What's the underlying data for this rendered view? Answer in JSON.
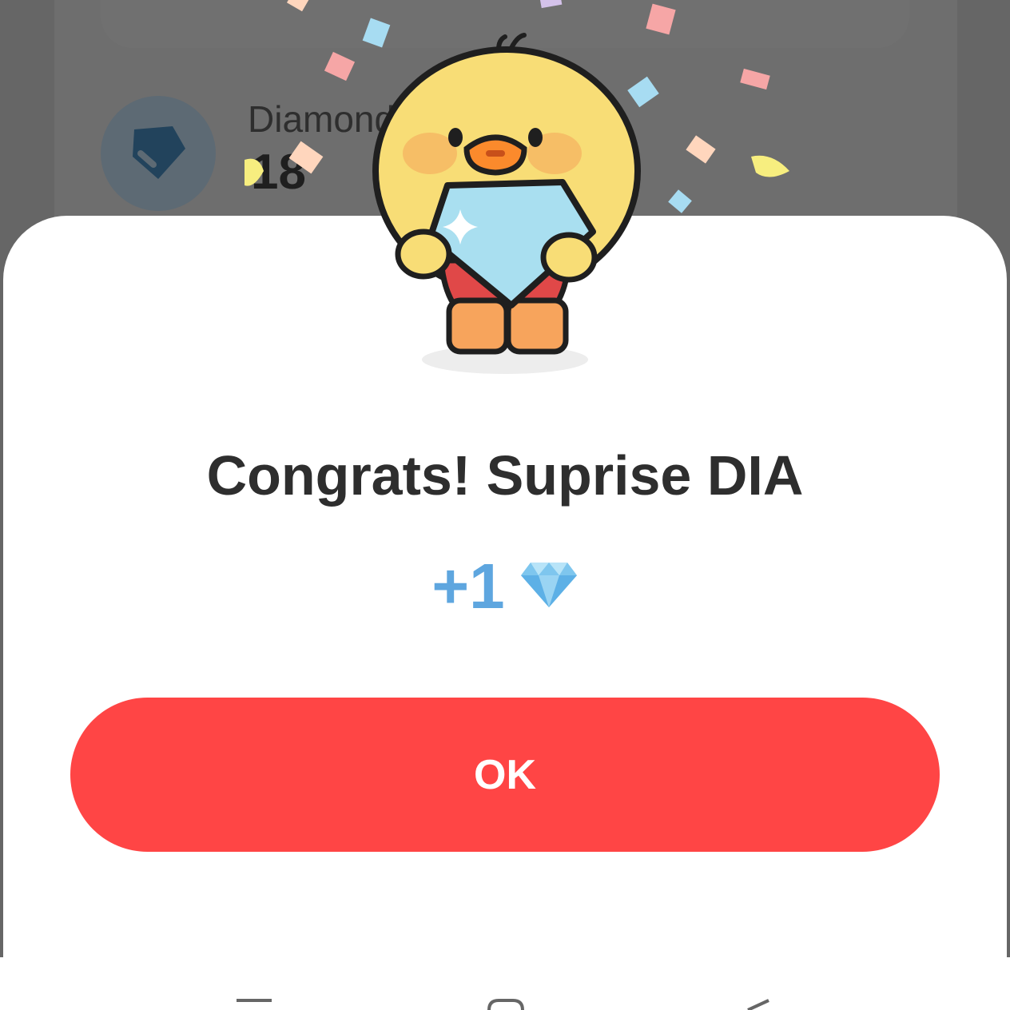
{
  "background": {
    "item_label": "Diamond",
    "item_count": "18"
  },
  "dialog": {
    "title": "Congrats! Suprise DIA",
    "reward_amount": "+1",
    "ok_label": "OK"
  },
  "colors": {
    "accent": "#ff4545",
    "reward_text": "#5ea6df",
    "title_text": "#2e2e2e"
  },
  "icons": {
    "mascot": "duck-holding-diamond-icon",
    "reward": "diamond-icon",
    "background_item": "gem-icon",
    "nav": [
      "recents-icon",
      "home-icon",
      "back-icon"
    ]
  }
}
